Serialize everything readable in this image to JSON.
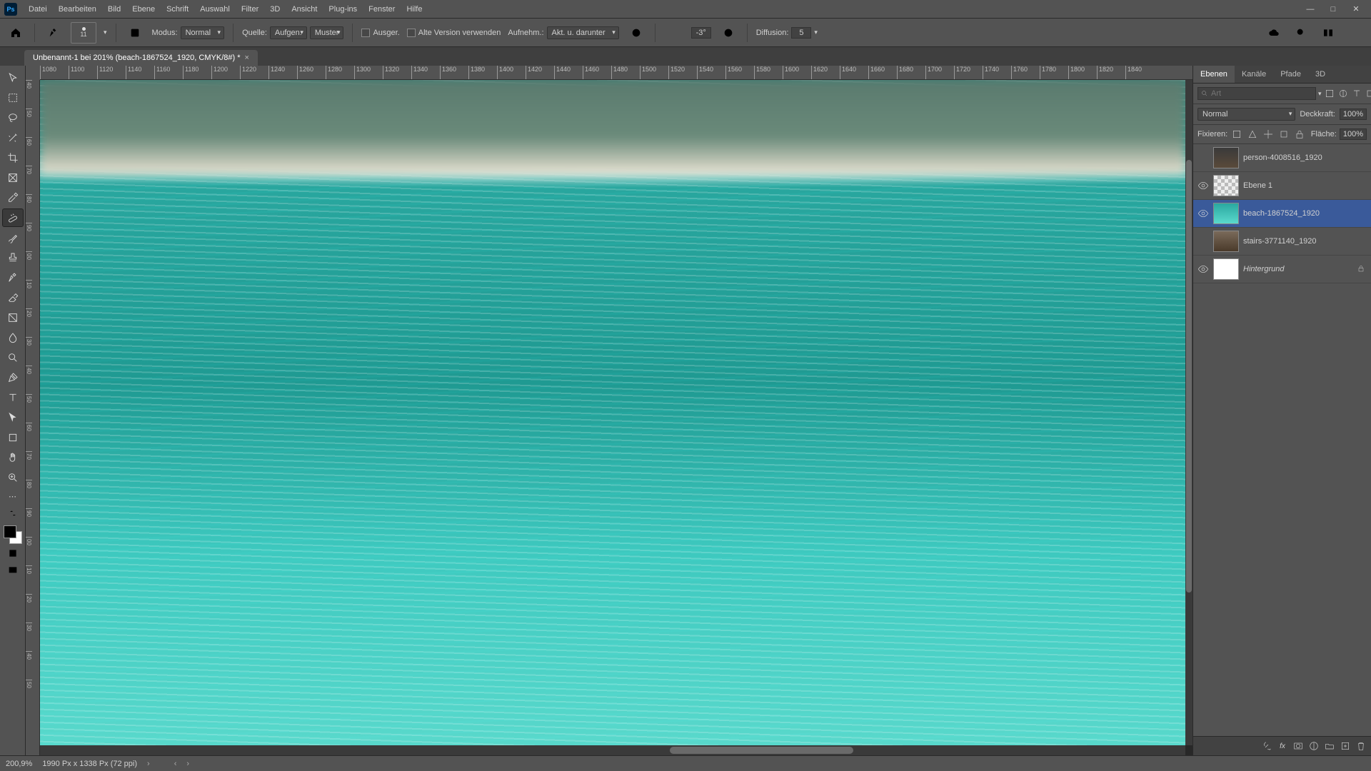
{
  "app": {
    "logo_text": "Ps"
  },
  "menu": {
    "items": [
      "Datei",
      "Bearbeiten",
      "Bild",
      "Ebene",
      "Schrift",
      "Auswahl",
      "Filter",
      "3D",
      "Ansicht",
      "Plug-ins",
      "Fenster",
      "Hilfe"
    ]
  },
  "window_controls": {
    "min": "—",
    "max": "□",
    "close": "✕"
  },
  "options": {
    "brush_size": "11",
    "mode_label": "Modus:",
    "mode_value": "Normal",
    "source_label": "Quelle:",
    "btn_aufgen": "Aufgen.",
    "btn_muster": "Muster",
    "chk_ausger": "Ausger.",
    "chk_alte": "Alte Version verwenden",
    "sample_label": "Aufnehm.:",
    "sample_value": "Akt. u. darunter",
    "angle_value": "-3°",
    "diffusion_label": "Diffusion:",
    "diffusion_value": "5"
  },
  "document": {
    "tab_title": "Unbenannt-1 bei 201% (beach-1867524_1920, CMYK/8#) *"
  },
  "ruler_h": [
    "1080",
    "1100",
    "1120",
    "1140",
    "1160",
    "1180",
    "1200",
    "1220",
    "1240",
    "1260",
    "1280",
    "1300",
    "1320",
    "1340",
    "1360",
    "1380",
    "1400",
    "1420",
    "1440",
    "1460",
    "1480",
    "1500",
    "1520",
    "1540",
    "1560",
    "1580",
    "1600",
    "1620",
    "1640",
    "1660",
    "1680",
    "1700",
    "1720",
    "1740",
    "1760",
    "1780",
    "1800",
    "1820",
    "1840"
  ],
  "ruler_v": [
    "40",
    "50",
    "60",
    "70",
    "80",
    "90",
    "00",
    "10",
    "20",
    "30",
    "40",
    "50",
    "60",
    "70",
    "80",
    "90",
    "00",
    "10",
    "20",
    "30",
    "40",
    "50"
  ],
  "panels": {
    "tabs": [
      "Ebenen",
      "Kanäle",
      "Pfade",
      "3D"
    ],
    "search_placeholder": "Art",
    "blend_mode": "Normal",
    "opacity_label": "Deckkraft:",
    "opacity_value": "100%",
    "lock_label": "Fixieren:",
    "fill_label": "Fläche:",
    "fill_value": "100%",
    "layers": [
      {
        "visible": false,
        "thumb": "person",
        "name": "person-4008516_1920",
        "locked": false,
        "selected": false,
        "italic": false
      },
      {
        "visible": true,
        "thumb": "checker",
        "name": "Ebene 1",
        "locked": false,
        "selected": false,
        "italic": false
      },
      {
        "visible": true,
        "thumb": "water",
        "name": "beach-1867524_1920",
        "locked": false,
        "selected": true,
        "italic": false
      },
      {
        "visible": false,
        "thumb": "stairs",
        "name": "stairs-3771140_1920",
        "locked": false,
        "selected": false,
        "italic": false
      },
      {
        "visible": true,
        "thumb": "white",
        "name": "Hintergrund",
        "locked": true,
        "selected": false,
        "italic": true
      }
    ]
  },
  "status": {
    "zoom": "200,9%",
    "docinfo": "1990 Px x 1338 Px (72 ppi)"
  }
}
